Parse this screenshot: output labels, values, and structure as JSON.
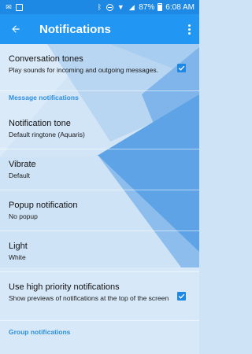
{
  "status_bar": {
    "battery": "87%",
    "time": "6:08 AM"
  },
  "app_bar": {
    "title": "Notifications"
  },
  "settings": {
    "conversation_tones": {
      "title": "Conversation tones",
      "subtitle": "Play sounds for incoming and outgoing messages.",
      "checked": true
    },
    "message_notifications_header": "Message notifications",
    "notification_tone": {
      "title": "Notification tone",
      "subtitle": "Default ringtone (Aquaris)"
    },
    "vibrate": {
      "title": "Vibrate",
      "subtitle": "Default"
    },
    "popup_notification": {
      "title": "Popup notification",
      "subtitle": "No popup"
    },
    "light": {
      "title": "Light",
      "subtitle": "White"
    },
    "high_priority": {
      "title": "Use high priority notifications",
      "subtitle": "Show previews of notifications at the top of the screen",
      "checked": true
    },
    "group_notifications_header": "Group notifications"
  },
  "colors": {
    "status_bar": "#1e88e5",
    "app_bar": "#2196f3",
    "accent": "#1e88e5",
    "section_header": "#2f8fe0"
  }
}
